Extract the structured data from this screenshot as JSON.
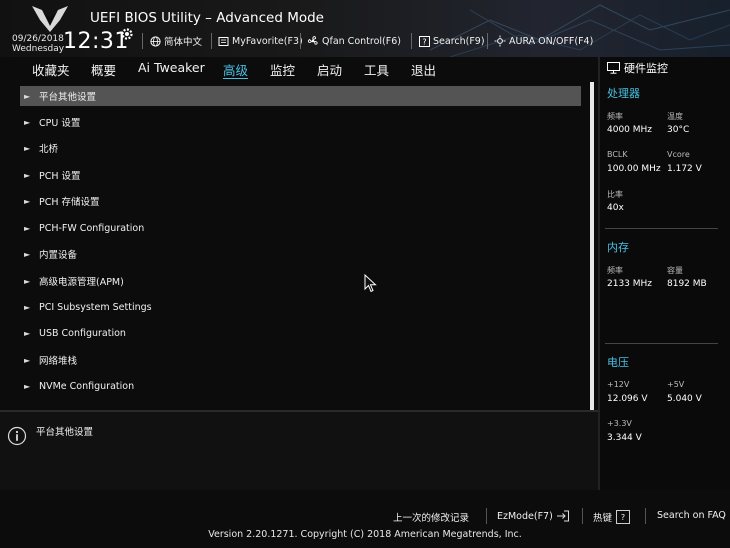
{
  "header": {
    "title": "UEFI BIOS Utility – Advanced Mode",
    "date": "09/26/2018",
    "weekday": "Wednesday",
    "time": "12:31",
    "tools": {
      "language": "简体中文",
      "myfavorite": "MyFavorite(F3)",
      "qfan": "Qfan Control(F6)",
      "search": "Search(F9)",
      "aura": "AURA ON/OFF(F4)"
    }
  },
  "menu": {
    "tabs": [
      "收藏夹",
      "概要",
      "Ai Tweaker",
      "高级",
      "监控",
      "启动",
      "工具",
      "退出"
    ],
    "active_index": 3
  },
  "items": [
    "平台其他设置",
    "CPU 设置",
    "北桥",
    "PCH 设置",
    "PCH 存储设置",
    "PCH-FW Configuration",
    "内置设备",
    "高级电源管理(APM)",
    "PCI Subsystem Settings",
    "USB Configuration",
    "网络堆栈",
    "NVMe Configuration"
  ],
  "selected_index": 0,
  "help": {
    "text": "平台其他设置"
  },
  "hw_monitor": {
    "title": "硬件监控",
    "cpu": {
      "title": "处理器",
      "freq_label": "频率",
      "freq_value": "4000 MHz",
      "temp_label": "温度",
      "temp_value": "30°C",
      "bclk_label": "BCLK",
      "bclk_value": "100.00 MHz",
      "vcore_label": "Vcore",
      "vcore_value": "1.172 V",
      "ratio_label": "比率",
      "ratio_value": "40x"
    },
    "memory": {
      "title": "内存",
      "freq_label": "频率",
      "freq_value": "2133 MHz",
      "cap_label": "容量",
      "cap_value": "8192 MB"
    },
    "voltage": {
      "title": "电压",
      "v12_label": "+12V",
      "v12_value": "12.096 V",
      "v5_label": "+5V",
      "v5_value": "5.040 V",
      "v33_label": "+3.3V",
      "v33_value": "3.344 V"
    }
  },
  "footer": {
    "last_modified": "上一次的修改记录",
    "ezmode": "EzMode(F7)",
    "hotkeys": "热键",
    "hotkeys_key": "?",
    "faq": "Search on FAQ",
    "version": "Version 2.20.1271. Copyright (C) 2018 American Megatrends, Inc."
  },
  "colors": {
    "accent": "#4ac0e3",
    "selection": "#545454",
    "background": "#0c0c0d"
  }
}
